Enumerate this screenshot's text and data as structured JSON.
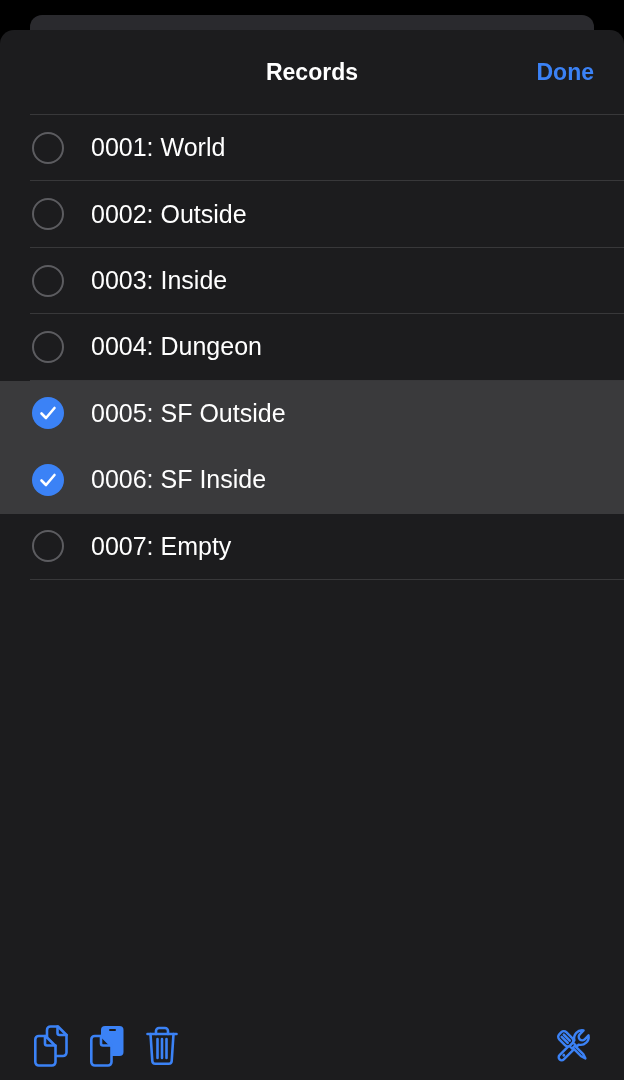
{
  "sheet": {
    "title": "Records",
    "done_button": "Done"
  },
  "records": [
    {
      "label": "0001: World",
      "selected": false
    },
    {
      "label": "0002: Outside",
      "selected": false
    },
    {
      "label": "0003: Inside",
      "selected": false
    },
    {
      "label": "0004: Dungeon",
      "selected": false
    },
    {
      "label": "0005: SF Outside",
      "selected": true
    },
    {
      "label": "0006: SF Inside",
      "selected": true
    },
    {
      "label": "0007: Empty",
      "selected": false
    }
  ]
}
